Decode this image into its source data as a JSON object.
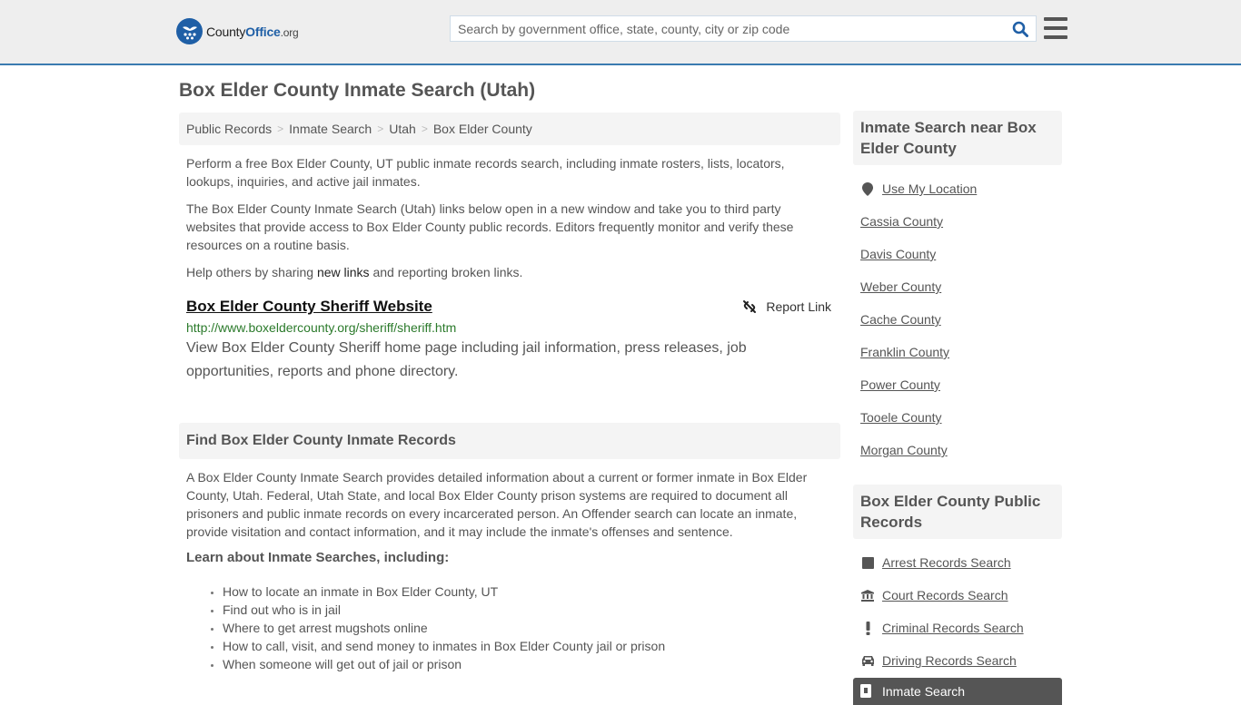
{
  "header": {
    "logo": {
      "part1": "County",
      "part2": "Office",
      "part3": ".org"
    },
    "search_placeholder": "Search by government office, state, county, city or zip code",
    "search_value": "",
    "accent": "#3a7bb0",
    "brand": "#1f5fa6"
  },
  "page": {
    "title": "Box Elder County Inmate Search (Utah)"
  },
  "breadcrumb": [
    {
      "label": "Public Records"
    },
    {
      "label": "Inmate Search"
    },
    {
      "label": "Utah"
    },
    {
      "label": "Box Elder County"
    }
  ],
  "breadcrumb_sep": ">",
  "intro": {
    "p1": "Perform a free Box Elder County, UT public inmate records search, including inmate rosters, lists, locators, lookups, inquiries, and active jail inmates.",
    "p2": "The Box Elder County Inmate Search (Utah) links below open in a new window and take you to third party websites that provide access to Box Elder County public records. Editors frequently monitor and verify these resources on a routine basis.",
    "p3_before": "Help others by sharing ",
    "p3_link": "new links",
    "p3_after": " and reporting broken links."
  },
  "results": [
    {
      "title": "Box Elder County Sheriff Website",
      "url": "http://www.boxeldercounty.org/sheriff/sheriff.htm",
      "description": "View Box Elder County Sheriff home page including jail information, press releases, job opportunities, reports and phone directory.",
      "report_label": "Report Link"
    }
  ],
  "find_section": {
    "heading": "Find Box Elder County Inmate Records",
    "body": "A Box Elder County Inmate Search provides detailed information about a current or former inmate in Box Elder County, Utah. Federal, Utah State, and local Box Elder County prison systems are required to document all prisoners and public inmate records on every incarcerated person. An Offender search can locate an inmate, provide visitation and contact information, and it may include the inmate's offenses and sentence.",
    "learn_heading": "Learn about Inmate Searches, including:",
    "learn_items": [
      "How to locate an inmate in Box Elder County, UT",
      "Find out who is in jail",
      "Where to get arrest mugshots online",
      "How to call, visit, and send money to inmates in Box Elder County jail or prison",
      "When someone will get out of jail or prison"
    ]
  },
  "sidebar": {
    "nearby_heading": "Inmate Search near Box Elder County",
    "use_location": "Use My Location",
    "nearby": [
      "Cassia County",
      "Davis County",
      "Weber County",
      "Cache County",
      "Franklin County",
      "Power County",
      "Tooele County",
      "Morgan County"
    ],
    "records_heading": "Box Elder County Public Records",
    "records": [
      {
        "label": "Arrest Records Search",
        "icon": "square-icon"
      },
      {
        "label": "Court Records Search",
        "icon": "courthouse-icon"
      },
      {
        "label": "Criminal Records Search",
        "icon": "exclamation-icon"
      },
      {
        "label": "Driving Records Search",
        "icon": "car-icon"
      }
    ],
    "active_record": {
      "label": "Inmate Search",
      "icon": "id-badge-icon"
    }
  }
}
